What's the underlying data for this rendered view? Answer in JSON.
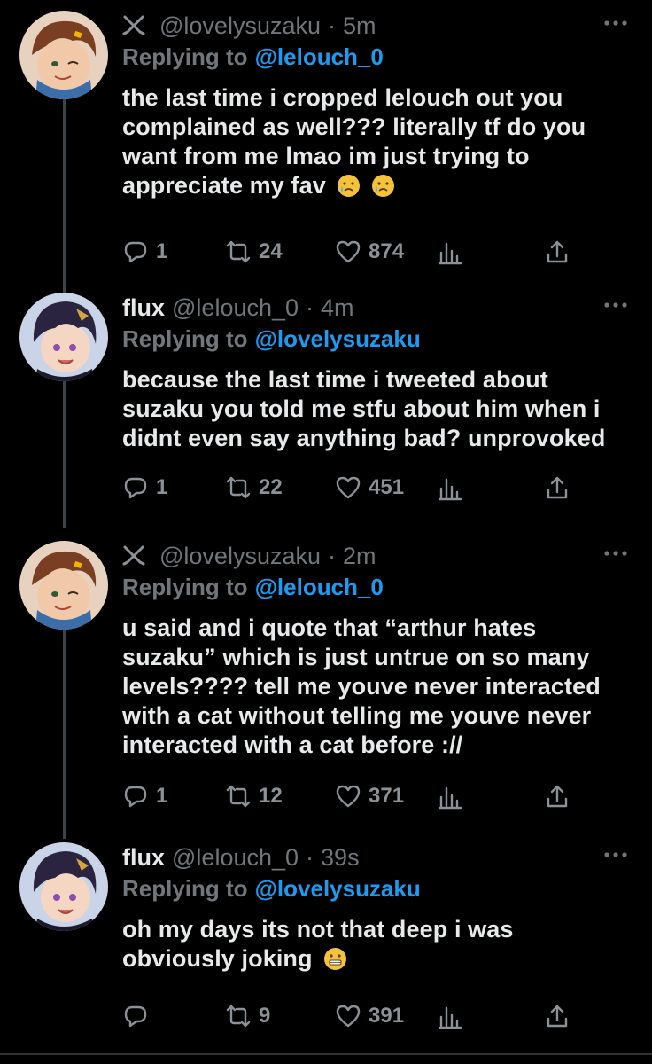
{
  "tweets": [
    {
      "display_name": "",
      "has_swords_icon": true,
      "handle": "@lovelysuzaku",
      "time": "5m",
      "reply_label": "Replying to",
      "reply_to": "@lelouch_0",
      "text": "the last time i cropped lelouch out you complained as well??? literally tf do you want from me lmao im just trying to appreciate my fav",
      "emoji": [
        "crying-face",
        "crying-face"
      ],
      "replies": "1",
      "retweets": "24",
      "likes": "874"
    },
    {
      "display_name": "flux",
      "has_swords_icon": false,
      "handle": "@lelouch_0",
      "time": "4m",
      "reply_label": "Replying to",
      "reply_to": "@lovelysuzaku",
      "text": "because the last time i tweeted about suzaku you told me stfu about him when i didnt even say anything bad? unprovoked",
      "emoji": [],
      "replies": "1",
      "retweets": "22",
      "likes": "451"
    },
    {
      "display_name": "",
      "has_swords_icon": true,
      "handle": "@lovelysuzaku",
      "time": "2m",
      "reply_label": "Replying to",
      "reply_to": "@lelouch_0",
      "text": "u said and i quote that “arthur hates suzaku” which is just untrue on so many levels???? tell me youve never interacted with a cat without telling me youve never interacted with a cat before ://",
      "emoji": [],
      "replies": "1",
      "retweets": "12",
      "likes": "371"
    },
    {
      "display_name": "flux",
      "has_swords_icon": false,
      "handle": "@lelouch_0",
      "time": "39s",
      "reply_label": "Replying to",
      "reply_to": "@lovelysuzaku",
      "text": "oh my days its not that deep i was obviously joking",
      "emoji": [
        "grimacing-face"
      ],
      "replies": "",
      "retweets": "9",
      "likes": "391"
    }
  ],
  "colors": {
    "background": "#000000",
    "text": "#e7e9ea",
    "muted": "#71767b",
    "link": "#1d9bf0",
    "thread_line": "#3d4449"
  },
  "separator": "·",
  "icons": [
    "swords-icon",
    "more-icon",
    "reply-icon",
    "retweet-icon",
    "like-icon",
    "analytics-icon",
    "share-icon"
  ]
}
